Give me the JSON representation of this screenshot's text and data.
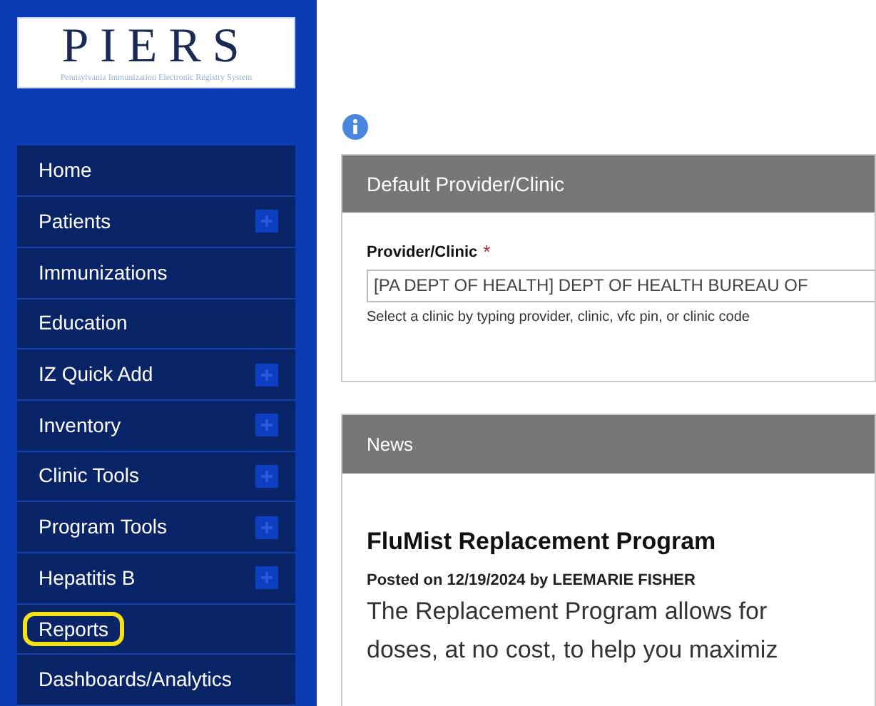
{
  "logo": {
    "title": "PIERS",
    "subtitle": "Pennsylvania Immunization Electronic Registry System"
  },
  "sidebar": {
    "items": [
      {
        "label": "Home",
        "expandable": false,
        "highlighted": false
      },
      {
        "label": "Patients",
        "expandable": true,
        "highlighted": false
      },
      {
        "label": "Immunizations",
        "expandable": false,
        "highlighted": false
      },
      {
        "label": "Education",
        "expandable": false,
        "highlighted": false
      },
      {
        "label": "IZ Quick Add",
        "expandable": true,
        "highlighted": false
      },
      {
        "label": "Inventory",
        "expandable": true,
        "highlighted": false
      },
      {
        "label": "Clinic Tools",
        "expandable": true,
        "highlighted": false
      },
      {
        "label": "Program Tools",
        "expandable": true,
        "highlighted": false
      },
      {
        "label": "Hepatitis B",
        "expandable": true,
        "highlighted": false
      },
      {
        "label": "Reports",
        "expandable": false,
        "highlighted": true
      },
      {
        "label": "Dashboards/Analytics",
        "expandable": false,
        "highlighted": false
      }
    ]
  },
  "provider_panel": {
    "title": "Default Provider/Clinic",
    "field_label": "Provider/Clinic",
    "required_mark": "*",
    "value": "[PA DEPT OF HEALTH] DEPT OF HEALTH BUREAU OF",
    "help": "Select a clinic by typing provider, clinic, vfc pin, or clinic code"
  },
  "news_panel": {
    "title": "News",
    "headline": "FluMist Replacement Program",
    "byline": "Posted on 12/19/2024 by LEEMARIE FISHER",
    "body_lines": [
      "The Replacement Program allows for",
      "doses, at no cost, to help you maximiz"
    ]
  }
}
